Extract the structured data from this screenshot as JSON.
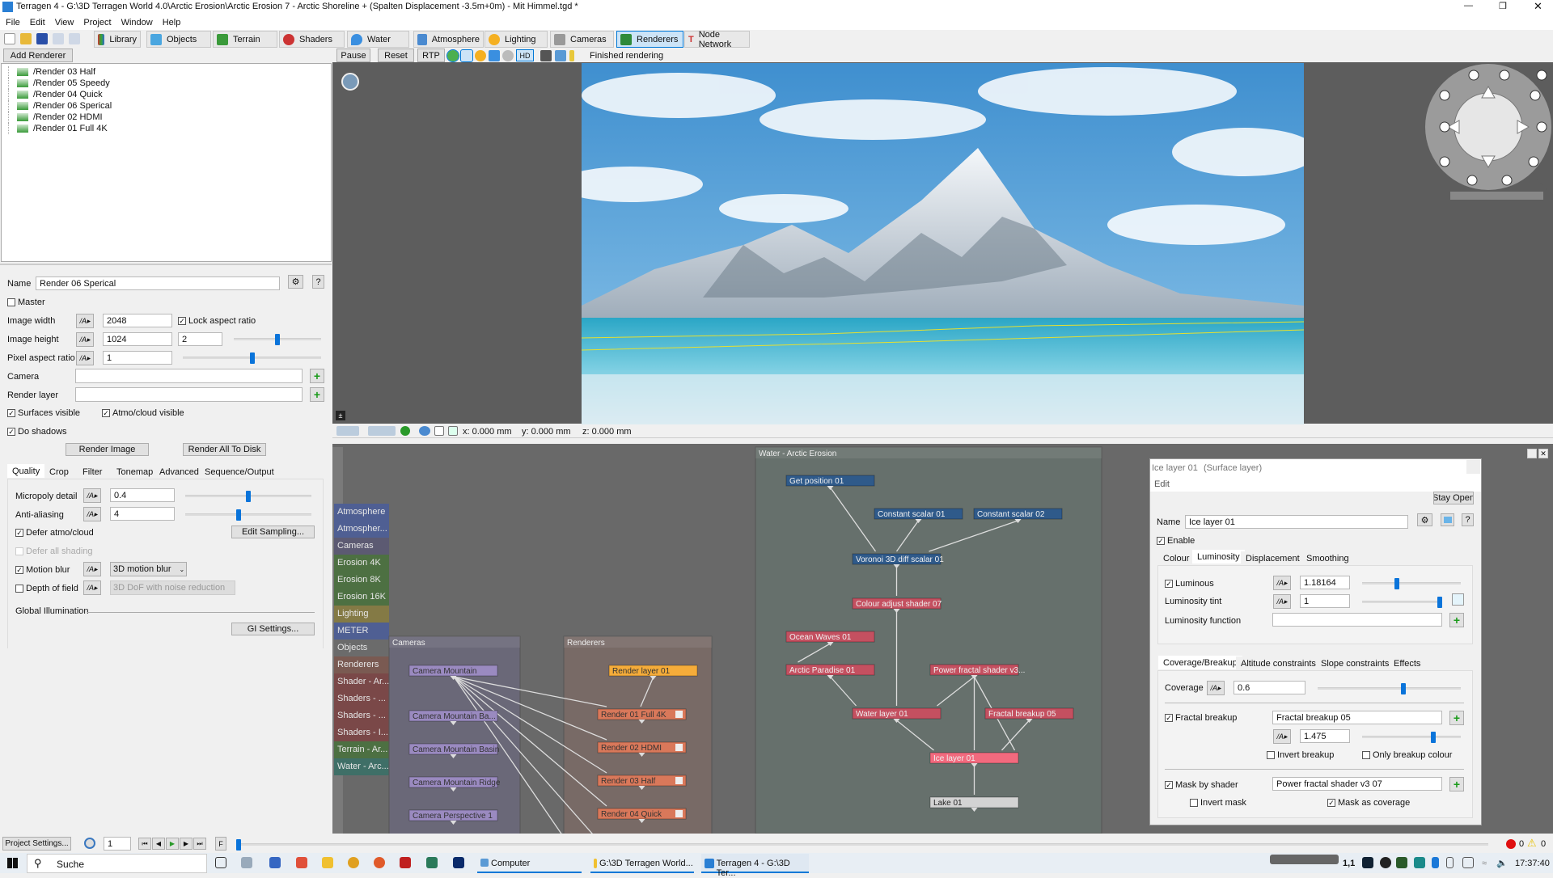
{
  "window": {
    "title": "Terragen 4 - G:\\3D Terragen World 4.0\\Arctic Erosion\\Arctic Erosion 7 - Arctic Shoreline + (Spalten Displacement -3.5m+0m) - Mit Himmel.tgd *"
  },
  "menu": [
    "File",
    "Edit",
    "View",
    "Project",
    "Window",
    "Help"
  ],
  "toolbar": {
    "tabs": [
      "Library",
      "Objects",
      "Terrain",
      "Shaders",
      "Water",
      "Atmosphere",
      "Lighting",
      "Cameras",
      "Renderers",
      "Node Network"
    ],
    "active": "Renderers"
  },
  "render_toolbar": {
    "add_renderer": "Add Renderer",
    "pause": "Pause",
    "reset": "Reset",
    "rtp": "RTP",
    "hd": "HD",
    "status": "Finished rendering"
  },
  "renderers_list": [
    "/Render 03 Half",
    "/Render 05 Speedy",
    "/Render 04 Quick",
    "/Render 06 Sperical",
    "/Render 02 HDMI",
    "/Render 01 Full 4K"
  ],
  "render_props": {
    "name_label": "Name",
    "name": "Render 06 Sperical",
    "help": "?",
    "master": "Master",
    "image_width_label": "Image width",
    "image_width": "2048",
    "lock_aspect": "Lock aspect ratio",
    "image_height_label": "Image height",
    "image_height": "1024",
    "aspect_value": "2",
    "pixel_aspect_label": "Pixel aspect ratio",
    "pixel_aspect": "1",
    "camera_label": "Camera",
    "camera": "",
    "render_layer_label": "Render layer",
    "render_layer": "",
    "surfaces_visible": "Surfaces visible",
    "atmo_visible": "Atmo/cloud visible",
    "do_shadows": "Do shadows",
    "render_image": "Render Image",
    "render_all": "Render All To Disk",
    "tabs": [
      "Quality",
      "Crop",
      "Filter",
      "Tonemap",
      "Advanced",
      "Sequence/Output"
    ],
    "micropoly_label": "Micropoly detail",
    "micropoly": "0.4",
    "micropoly_slider": 0.5,
    "antialias_label": "Anti-aliasing",
    "antialias": "4",
    "antialias_slider": 0.42,
    "height_slider": 0.5,
    "pixel_aspect_slider": 0.5,
    "defer_atmo": "Defer atmo/cloud",
    "edit_sampling": "Edit Sampling...",
    "defer_shading": "Defer all shading",
    "motion_blur": "Motion blur",
    "motion_blur_mode": "3D motion blur",
    "dof": "Depth of field",
    "dof_mode": "3D DoF with noise reduction",
    "gi_label": "Global Illumination",
    "gi_settings": "GI Settings..."
  },
  "viewport": {
    "x": "x: 0.000 mm",
    "y": "y: 0.000 mm",
    "z": "z: 0.000 mm"
  },
  "node_network": {
    "categories": [
      {
        "label": "Atmosphere",
        "color": "#4f5f93"
      },
      {
        "label": "Atmospher...",
        "color": "#4f5f93"
      },
      {
        "label": "Cameras",
        "color": "#5c5a72"
      },
      {
        "label": "Erosion 4K",
        "color": "#4d7042"
      },
      {
        "label": "Erosion 8K",
        "color": "#4d7042"
      },
      {
        "label": "Erosion 16K",
        "color": "#4d7042"
      },
      {
        "label": "Lighting",
        "color": "#847a45"
      },
      {
        "label": "METER",
        "color": "#4f5f93"
      },
      {
        "label": "Objects",
        "color": "#6b6b6b"
      },
      {
        "label": "Renderers",
        "color": "#7a5a52"
      },
      {
        "label": "Shader - Ar...",
        "color": "#7a4848"
      },
      {
        "label": "Shaders - ...",
        "color": "#7a4848"
      },
      {
        "label": "Shaders - ...",
        "color": "#7a4848"
      },
      {
        "label": "Shaders - I...",
        "color": "#7a4848"
      },
      {
        "label": "Terrain - Ar...",
        "color": "#4d7042"
      },
      {
        "label": "Water - Arc...",
        "color": "#3f6f67"
      }
    ],
    "groups": {
      "cameras": "Cameras",
      "renderers": "Renderers",
      "water": "Water - Arctic Erosion"
    },
    "camera_nodes": [
      "Camera Mountain",
      "Camera Mountain Ba...",
      "Camera Mountain Basin",
      "Camera Mountain Ridge",
      "Camera Perspective 1"
    ],
    "render_nodes": [
      "Render layer 01",
      "Render 01 Full 4K",
      "Render 02 HDMI",
      "Render 03 Half",
      "Render 04 Quick"
    ],
    "water_nodes": [
      "Get position 01",
      "Constant scalar 01",
      "Constant scalar 02",
      "Voronoi 3D diff scalar 01",
      "Colour adjust shader 07",
      "Ocean Waves 01",
      "Arctic Paradise 01",
      "Power fractal shader v3...",
      "Water layer 01",
      "Fractal breakup 05",
      "Ice layer 01",
      "Lake 01"
    ],
    "colors": {
      "function": "#2f5a8a",
      "shader": "#c45060",
      "selected": "#f26a7e",
      "camera": "#9a8ac0",
      "render": "#d9785a",
      "render_layer": "#f5ac3a",
      "lake": "#d3d3d3"
    }
  },
  "surface_panel": {
    "title": "Ice layer 01",
    "subtitle": "(Surface layer)",
    "edit": "Edit",
    "stay_open": "Stay Open",
    "name_label": "Name",
    "name": "Ice layer 01",
    "help": "?",
    "enable": "Enable",
    "tabs": [
      "Colour",
      "Luminosity",
      "Displacement",
      "Smoothing"
    ],
    "luminous": "Luminous",
    "luminous_value": "1.18164",
    "luminous_slider": 0.35,
    "tint_label": "Luminosity tint",
    "tint_value": "1",
    "tint_slider": 1.0,
    "function_label": "Luminosity function",
    "function_value": "",
    "tabs2": [
      "Coverage/Breakup",
      "Altitude constraints",
      "Slope constraints",
      "Effects"
    ],
    "coverage_label": "Coverage",
    "coverage": "0.6",
    "coverage_slider": 0.6,
    "fractal_breakup": "Fractal breakup",
    "fractal_breakup_value": "Fractal breakup 05",
    "breakup_amount": "1.475",
    "breakup_slider": 0.72,
    "invert_breakup": "Invert breakup",
    "only_breakup_colour": "Only breakup colour",
    "mask_by_shader": "Mask by shader",
    "mask_shader": "Power fractal shader v3 07",
    "invert_mask": "Invert mask",
    "mask_as_coverage": "Mask as coverage"
  },
  "timeline": {
    "project_settings": "Project Settings...",
    "frame": "1",
    "errors": "0",
    "warnings": "0"
  },
  "taskbar": {
    "search": "Suche",
    "apps": [
      "Computer",
      "G:\\3D Terragen World...",
      "Terragen 4 - G:\\3D Ter..."
    ],
    "lang": "1,1",
    "time": "17:37:40"
  }
}
